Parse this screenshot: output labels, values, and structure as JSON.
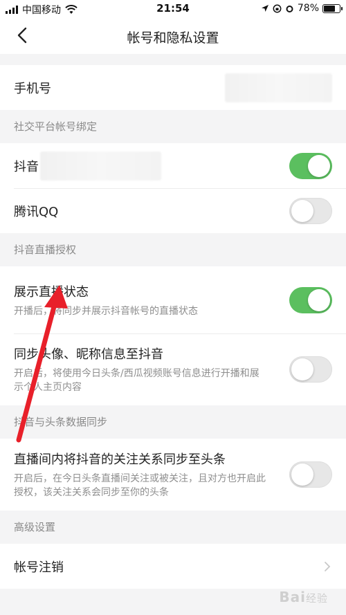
{
  "status_bar": {
    "carrier": "中国移动",
    "time": "21:54",
    "battery": "78%",
    "battery_level": 0.78
  },
  "header": {
    "title": "帐号和隐私设置"
  },
  "phone_row": {
    "label": "手机号"
  },
  "social": {
    "section": "社交平台帐号绑定",
    "douyin": {
      "label": "抖音",
      "on": true
    },
    "qq": {
      "label": "腾讯QQ",
      "on": false
    }
  },
  "live_auth": {
    "section": "抖音直播授权",
    "show_live": {
      "label": "展示直播状态",
      "desc": "开播后，将同步并展示抖音帐号的直播状态",
      "on": true
    },
    "sync_avatar": {
      "label": "同步头像、昵称信息至抖音",
      "desc": "开启后，将使用今日头条/西瓜视频账号信息进行开播和展示个人主页内容",
      "on": false
    }
  },
  "data_sync": {
    "section": "抖音与头条数据同步",
    "follow_sync": {
      "label": "直播间内将抖音的关注关系同步至头条",
      "desc": "开启后，在今日头条直播间关注或被关注，且对方也开启此授权，该关注关系会同步至你的头条",
      "on": false
    }
  },
  "advanced": {
    "section": "高级设置",
    "delete_account": {
      "label": "帐号注销"
    }
  },
  "watermark": {
    "text": "Bai",
    "sub": "经验"
  },
  "colors": {
    "toggle_on": "#5bbf5f",
    "arrow": "#e8202a"
  }
}
